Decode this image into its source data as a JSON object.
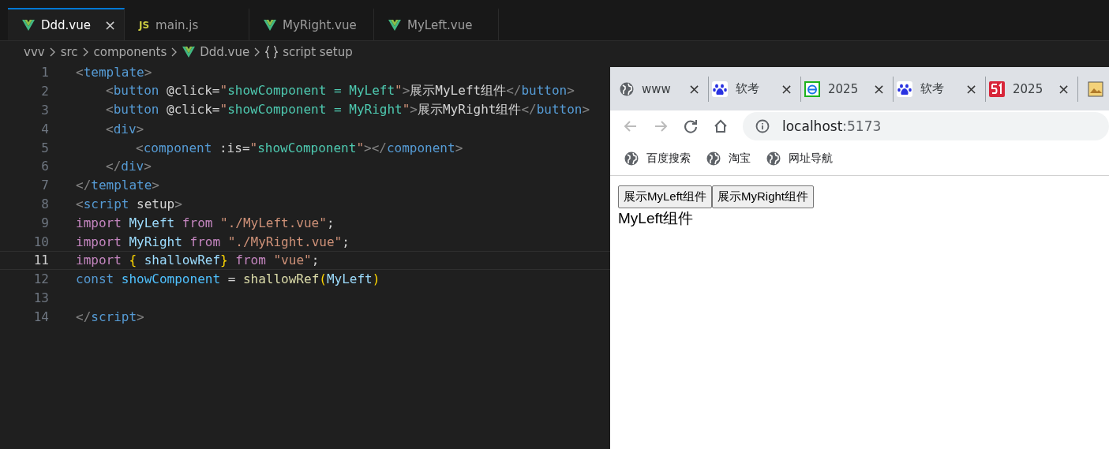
{
  "editor": {
    "tabs": [
      {
        "label": "Ddd.vue",
        "close": "×",
        "selected": true
      },
      {
        "label": "main.js",
        "badge": "JS",
        "selected": false
      },
      {
        "label": "MyRight.vue",
        "selected": false
      },
      {
        "label": "MyLeft.vue",
        "selected": false
      }
    ],
    "breadcrumbs": [
      "vvv",
      "src",
      "components",
      "Ddd.vue",
      "script setup"
    ],
    "lines": [
      {
        "number": "1",
        "current": false,
        "tokens": [
          {
            "kind": "punct",
            "text": "<"
          },
          {
            "kind": "tag",
            "text": "template"
          },
          {
            "kind": "punct",
            "text": ">"
          }
        ],
        "children": [
          {
            "number": "2",
            "current": false,
            "tokens": [
              {
                "kind": "punct",
                "text": "<"
              },
              {
                "kind": "tag",
                "text": "button"
              },
              {
                "kind": "plain",
                "text": " @click="
              },
              {
                "kind": "string",
                "text": "\""
              },
              {
                "kind": "expr",
                "text": "showComponent = MyLeft"
              },
              {
                "kind": "string",
                "text": "\""
              },
              {
                "kind": "punct",
                "text": ">"
              },
              {
                "kind": "plain",
                "text": "展示MyLeft组件"
              },
              {
                "kind": "punct",
                "text": "</"
              },
              {
                "kind": "tag",
                "text": "button"
              },
              {
                "kind": "punct",
                "text": ">"
              }
            ]
          },
          {
            "number": "3",
            "current": false,
            "tokens": [
              {
                "kind": "punct",
                "text": "<"
              },
              {
                "kind": "tag",
                "text": "button"
              },
              {
                "kind": "plain",
                "text": " @click="
              },
              {
                "kind": "string",
                "text": "\""
              },
              {
                "kind": "expr",
                "text": "showComponent = MyRight"
              },
              {
                "kind": "string",
                "text": "\""
              },
              {
                "kind": "punct",
                "text": ">"
              },
              {
                "kind": "plain",
                "text": "展示MyRight组件"
              },
              {
                "kind": "punct",
                "text": "</"
              },
              {
                "kind": "tag",
                "text": "button"
              },
              {
                "kind": "punct",
                "text": ">"
              }
            ]
          },
          {
            "number": "4",
            "current": false,
            "tokens": [
              {
                "kind": "punct",
                "text": "<"
              },
              {
                "kind": "tag",
                "text": "div"
              },
              {
                "kind": "punct",
                "text": ">"
              }
            ],
            "children": [
              {
                "number": "5",
                "current": false,
                "tokens": [
                  {
                    "kind": "punct",
                    "text": "<"
                  },
                  {
                    "kind": "tag",
                    "text": "component"
                  },
                  {
                    "kind": "plain",
                    "text": " :is="
                  },
                  {
                    "kind": "string",
                    "text": "\""
                  },
                  {
                    "kind": "expr",
                    "text": "showComponent"
                  },
                  {
                    "kind": "string",
                    "text": "\""
                  },
                  {
                    "kind": "punct",
                    "text": "></"
                  },
                  {
                    "kind": "tag",
                    "text": "component"
                  },
                  {
                    "kind": "punct",
                    "text": ">"
                  }
                ]
              }
            ]
          },
          {
            "number": "6",
            "current": false,
            "tokens": [
              {
                "kind": "punct",
                "text": "</"
              },
              {
                "kind": "tag",
                "text": "div"
              },
              {
                "kind": "punct",
                "text": ">"
              }
            ]
          }
        ]
      },
      {
        "number": "7",
        "current": false,
        "tokens": [
          {
            "kind": "punct",
            "text": "</"
          },
          {
            "kind": "tag",
            "text": "template"
          },
          {
            "kind": "punct",
            "text": ">"
          }
        ]
      },
      {
        "number": "8",
        "current": false,
        "tokens": [
          {
            "kind": "punct",
            "text": "<"
          },
          {
            "kind": "tag",
            "text": "script"
          },
          {
            "kind": "plain",
            "text": " setup"
          },
          {
            "kind": "punct",
            "text": ">"
          }
        ]
      },
      {
        "number": "9",
        "current": false,
        "tokens": [
          {
            "kind": "keyword",
            "text": "import"
          },
          {
            "kind": "variable",
            "text": " MyLeft "
          },
          {
            "kind": "keyword",
            "text": "from"
          },
          {
            "kind": "string",
            "text": " \"./MyLeft.vue\""
          },
          {
            "kind": "plain",
            "text": ";"
          }
        ]
      },
      {
        "number": "10",
        "current": false,
        "tokens": [
          {
            "kind": "keyword",
            "text": "import"
          },
          {
            "kind": "variable",
            "text": " MyRight "
          },
          {
            "kind": "keyword",
            "text": "from"
          },
          {
            "kind": "string",
            "text": " \"./MyRight.vue\""
          },
          {
            "kind": "plain",
            "text": ";"
          }
        ]
      },
      {
        "number": "11",
        "current": true,
        "tokens": [
          {
            "kind": "keyword",
            "text": "import"
          },
          {
            "kind": "bracket",
            "text": " {"
          },
          {
            "kind": "variable",
            "text": " shallowRef"
          },
          {
            "kind": "bracket",
            "text": "}"
          },
          {
            "kind": "keyword",
            "text": " from"
          },
          {
            "kind": "string",
            "text": " \"vue\""
          },
          {
            "kind": "plain",
            "text": ";"
          }
        ]
      },
      {
        "number": "12",
        "current": false,
        "tokens": [
          {
            "kind": "storage",
            "text": "const"
          },
          {
            "kind": "constant",
            "text": " showComponent"
          },
          {
            "kind": "plain",
            "text": " = "
          },
          {
            "kind": "func",
            "text": "shallowRef"
          },
          {
            "kind": "bracket",
            "text": "("
          },
          {
            "kind": "variable",
            "text": "MyLeft"
          },
          {
            "kind": "bracket",
            "text": ")"
          }
        ]
      },
      {
        "number": "13",
        "current": false
      },
      {
        "number": "14",
        "current": false,
        "tokens": [
          {
            "kind": "punct",
            "text": "</"
          },
          {
            "kind": "tag",
            "text": "script"
          },
          {
            "kind": "punct",
            "text": ">"
          }
        ]
      }
    ]
  },
  "browser": {
    "tabs": [
      {
        "label": "www",
        "close": "×",
        "selected": false
      },
      {
        "label": "软考",
        "close": "×",
        "selected": false
      },
      {
        "label": "2025",
        "close": "×",
        "selected": false
      },
      {
        "label": "软考",
        "close": "×",
        "selected": false
      },
      {
        "label": "2025",
        "close": "×",
        "selected": false
      },
      {
        "selected": false
      }
    ],
    "address": {
      "host": "localhost",
      "port": ":5173"
    },
    "bookmarks": [
      "百度搜索",
      "淘宝",
      "网址导航"
    ],
    "page": {
      "buttons": [
        "展示MyLeft组件",
        "展示MyRight组件"
      ],
      "content": "MyLeft组件"
    }
  }
}
